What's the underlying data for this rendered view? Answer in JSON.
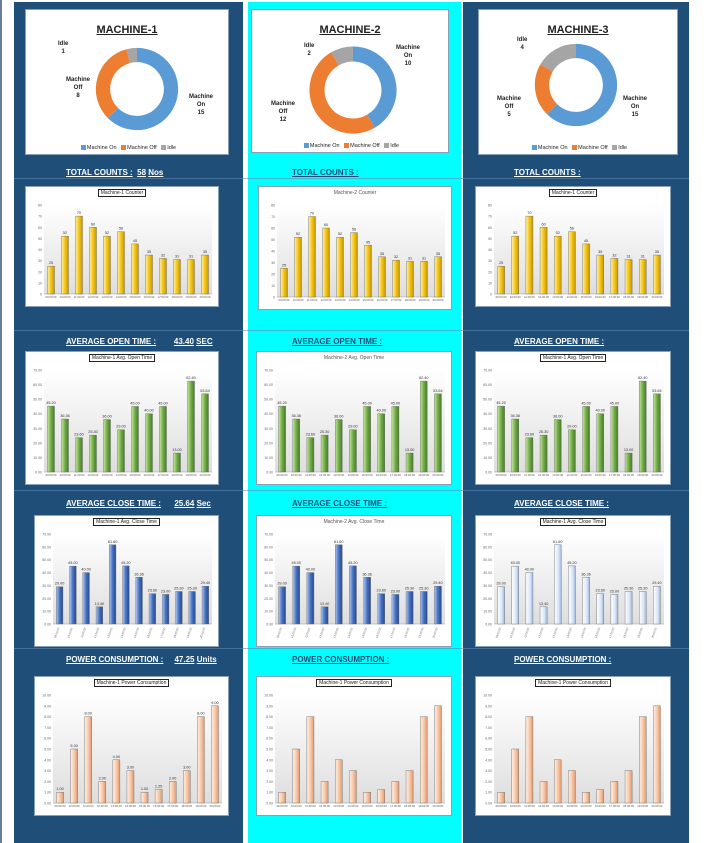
{
  "colors": {
    "on": "#5b9bd5",
    "off": "#ed7d31",
    "idle": "#a5a5a5",
    "dark": "#1f4e79",
    "cyan": "#00ffff"
  },
  "legend": {
    "on": "Machine On",
    "off": "Machine Off",
    "idle": "Idle"
  },
  "times": [
    "09:00:00",
    "10:00:00",
    "11:00:00",
    "12:00:00",
    "13:00:00",
    "14:00:00",
    "15:00:00",
    "16:00:00",
    "17:00:00",
    "18:00:00",
    "19:00:00",
    "20:00:00"
  ],
  "machines": [
    {
      "title": "MACHINE-1",
      "donut": {
        "on": {
          "label": "Machine On",
          "value": "15"
        },
        "off": {
          "label": "Machine Off",
          "value": "8"
        },
        "idle": {
          "label": "Idle",
          "value": "1"
        }
      },
      "total": {
        "label": "TOTAL COUNTS :",
        "value": "58",
        "unit": "Nos"
      },
      "open": {
        "label": "AVERAGE OPEN TIME :",
        "value": "43.40",
        "unit": "SEC"
      },
      "close": {
        "label": "AVERAGE CLOSE TIME :",
        "value": "25.64",
        "unit": "Sec"
      },
      "power": {
        "label": "POWER CONSUMPTION :",
        "value": "47.25",
        "unit": "Units"
      },
      "counter_title": "Machine-1 Counter",
      "open_title": "Machine-1 Avg. Open Time",
      "close_title": "Machine-1 Avg. Close Time",
      "power_title": "Machine-1 Power Consumption"
    },
    {
      "title": "MACHINE-2",
      "donut": {
        "on": {
          "label": "Machine On",
          "value": "10"
        },
        "off": {
          "label": "Machine Off",
          "value": "12"
        },
        "idle": {
          "label": "Idle",
          "value": "2"
        }
      },
      "total": {
        "label": "TOTAL COUNTS :",
        "value": "",
        "unit": ""
      },
      "open": {
        "label": "AVERAGE OPEN TIME :",
        "value": "",
        "unit": ""
      },
      "close": {
        "label": "AVERAGE CLOSE TIME :",
        "value": "",
        "unit": ""
      },
      "power": {
        "label": "POWER CONSUMPTION :",
        "value": "",
        "unit": ""
      },
      "counter_title": "Machine-2 Counter",
      "open_title": "Machine-2 Avg. Open Time",
      "close_title": "Machine-2 Avg. Close Time",
      "power_title": "Machine-1 Power Consumption"
    },
    {
      "title": "MACHINE-3",
      "donut": {
        "on": {
          "label": "Machine On",
          "value": "15"
        },
        "off": {
          "label": "Machine Off",
          "value": "5"
        },
        "idle": {
          "label": "Idle",
          "value": "4"
        }
      },
      "total": {
        "label": "TOTAL COUNTS :",
        "value": "",
        "unit": ""
      },
      "open": {
        "label": "AVERAGE OPEN TIME :",
        "value": "",
        "unit": ""
      },
      "close": {
        "label": "AVERAGE CLOSE TIME :",
        "value": "",
        "unit": ""
      },
      "power": {
        "label": "POWER CONSUMPTION :",
        "value": "",
        "unit": ""
      },
      "counter_title": "Machine-1 Counter",
      "open_title": "Machine-1 Avg. Open Time",
      "close_title": "Machine-1 Avg. Close Time",
      "power_title": "Machine-1 Power Consumption"
    }
  ],
  "chart_data": [
    {
      "type": "pie",
      "title": "MACHINE-1",
      "categories": [
        "Machine On",
        "Machine Off",
        "Idle"
      ],
      "values": [
        15,
        8,
        1
      ]
    },
    {
      "type": "pie",
      "title": "MACHINE-2",
      "categories": [
        "Machine On",
        "Machine Off",
        "Idle"
      ],
      "values": [
        10,
        12,
        2
      ]
    },
    {
      "type": "pie",
      "title": "MACHINE-3",
      "categories": [
        "Machine On",
        "Machine Off",
        "Idle"
      ],
      "values": [
        15,
        5,
        4
      ]
    },
    {
      "type": "bar",
      "title": "Machine Counter",
      "categories": [
        "09:00:00",
        "10:00:00",
        "11:00:00",
        "12:00:00",
        "13:00:00",
        "14:00:00",
        "15:00:00",
        "16:00:00",
        "17:00:00",
        "18:00:00",
        "19:00:00",
        "20:00:00"
      ],
      "values": [
        25,
        52,
        70,
        60,
        52,
        56,
        45,
        35,
        32,
        31,
        31,
        35
      ],
      "ylim": [
        0,
        80
      ],
      "yticks": [
        "0",
        "10",
        "20",
        "30",
        "40",
        "50",
        "60",
        "70",
        "80"
      ]
    },
    {
      "type": "bar",
      "title": "Avg. Open Time",
      "categories": [
        "09:00:00",
        "10:00:00",
        "11:00:00",
        "12:00:00",
        "13:00:00",
        "14:00:00",
        "15:00:00",
        "16:00:00",
        "17:00:00",
        "18:00:00",
        "19:00:00",
        "20:00:00"
      ],
      "values": [
        45.2,
        36.36,
        23.6,
        25.3,
        36.0,
        29.0,
        45.0,
        40.0,
        45.0,
        13.0,
        62.4,
        53.64
      ],
      "labels": [
        "45.20",
        "36.36",
        "23.60",
        "25.30",
        "36.00",
        "29.00",
        "45.00",
        "40.00",
        "45.00",
        "13.00",
        "62.40",
        "53.64"
      ],
      "ylim": [
        0,
        70
      ],
      "yticks": [
        "0.00",
        "10.00",
        "20.00",
        "30.00",
        "40.00",
        "50.00",
        "60.00",
        "70.00"
      ]
    },
    {
      "type": "bar",
      "title": "Avg. Close Time",
      "categories": [
        "09:00:00",
        "10:00:00",
        "11:00:00",
        "12:00:00",
        "13:00:00",
        "14:00:00",
        "15:00:00",
        "16:00:00",
        "17:00:00",
        "18:00:00",
        "19:00:00",
        "20:00:00"
      ],
      "values": [
        29.0,
        45.0,
        40.0,
        13.4,
        61.6,
        45.2,
        36.36,
        23.6,
        23.0,
        25.3,
        25.3,
        29.4
      ],
      "labels": [
        "29.00",
        "45.00",
        "40.00",
        "13.40",
        "61.60",
        "45.20",
        "36.36",
        "23.60",
        "23.00",
        "25.30",
        "25.30",
        "29.40"
      ],
      "ylim": [
        0,
        70
      ],
      "yticks": [
        "0.00",
        "10.00",
        "20.00",
        "30.00",
        "40.00",
        "50.00",
        "60.00",
        "70.00"
      ]
    },
    {
      "type": "bar",
      "title": "Power Consumption",
      "categories": [
        "09:00:00",
        "10:00:00",
        "11:00:00",
        "12:00:00",
        "13:00:00",
        "14:00:00",
        "15:00:00",
        "16:00:00",
        "17:00:00",
        "18:00:00",
        "19:00:00",
        "20:00:00"
      ],
      "values": [
        1.0,
        5.0,
        8.0,
        2.0,
        4.0,
        3.0,
        1.0,
        1.25,
        2.0,
        3.0,
        8.0,
        9.0
      ],
      "labels": [
        "1.00",
        "5.00",
        "8.00",
        "2.00",
        "4.00",
        "3.00",
        "1.00",
        "1.25",
        "2.00",
        "3.00",
        "8.00",
        "9.00"
      ],
      "ylim": [
        0,
        10
      ],
      "yticks": [
        "0.00",
        "1.00",
        "2.00",
        "3.00",
        "4.00",
        "5.00",
        "6.00",
        "7.00",
        "8.00",
        "9.00",
        "10.00"
      ]
    }
  ]
}
